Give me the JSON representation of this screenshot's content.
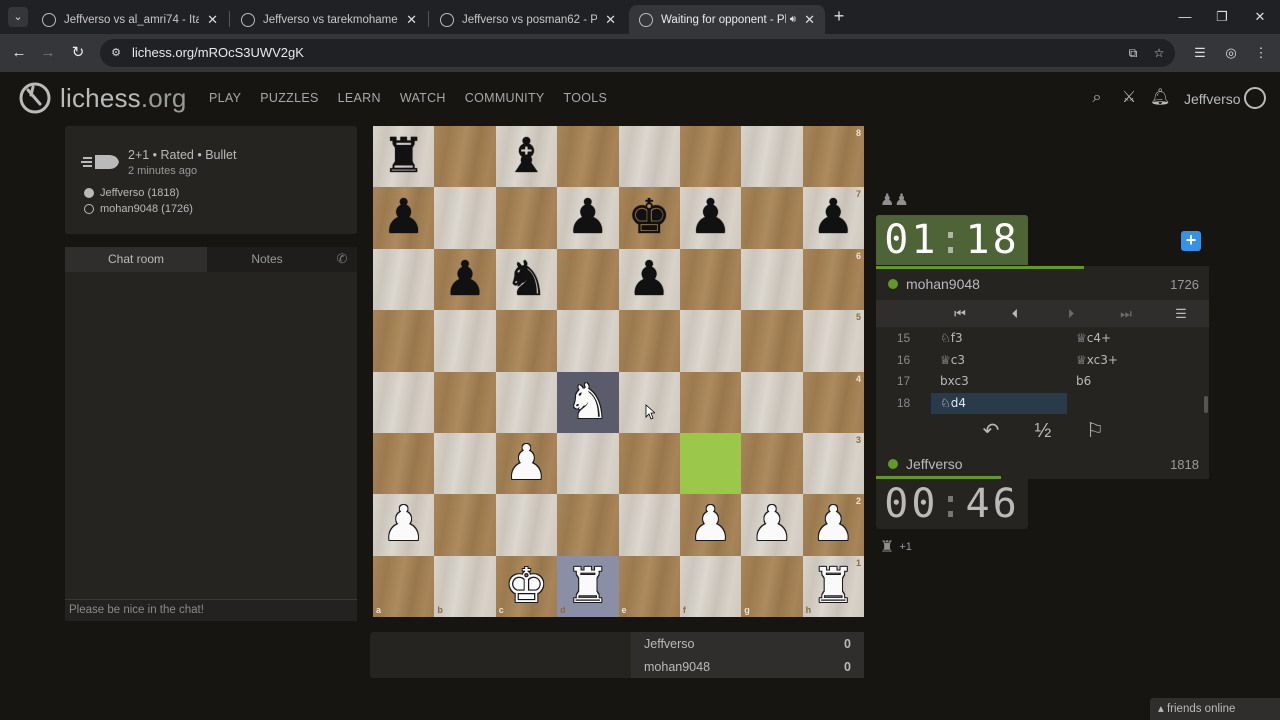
{
  "browser": {
    "tabs": [
      {
        "title": "Jeffverso vs al_amri74 - Italian G"
      },
      {
        "title": "Jeffverso vs tarekmohamedm -"
      },
      {
        "title": "Jeffverso vs posman62 - Philidc"
      },
      {
        "title": "Waiting for opponent - Play"
      }
    ],
    "url": "lichess.org/mROcS3UWV2gK"
  },
  "site": {
    "logo_main": "lichess",
    "logo_tld": ".org",
    "nav": [
      "PLAY",
      "PUZZLES",
      "LEARN",
      "WATCH",
      "COMMUNITY",
      "TOOLS"
    ],
    "username": "Jeffverso"
  },
  "game": {
    "type": "2+1 • Rated • Bullet",
    "time_ago": "2 minutes ago",
    "white_player": "Jeffverso (1818)",
    "black_player": "mohan9048 (1726)"
  },
  "chat": {
    "tab_chat": "Chat room",
    "tab_notes": "Notes",
    "placeholder": "Please be nice in the chat!"
  },
  "board": {
    "orientation": "white",
    "pieces": [
      {
        "sq": "a8",
        "color": "b",
        "type": "rook"
      },
      {
        "sq": "c8",
        "color": "b",
        "type": "bishop"
      },
      {
        "sq": "a7",
        "color": "b",
        "type": "pawn"
      },
      {
        "sq": "d7",
        "color": "b",
        "type": "pawn"
      },
      {
        "sq": "e7",
        "color": "b",
        "type": "king"
      },
      {
        "sq": "f7",
        "color": "b",
        "type": "pawn"
      },
      {
        "sq": "h7",
        "color": "b",
        "type": "pawn"
      },
      {
        "sq": "b6",
        "color": "b",
        "type": "pawn"
      },
      {
        "sq": "c6",
        "color": "b",
        "type": "knight"
      },
      {
        "sq": "e6",
        "color": "b",
        "type": "pawn"
      },
      {
        "sq": "d4",
        "color": "w",
        "type": "knight"
      },
      {
        "sq": "c3",
        "color": "w",
        "type": "pawn"
      },
      {
        "sq": "a2",
        "color": "w",
        "type": "pawn"
      },
      {
        "sq": "f2",
        "color": "w",
        "type": "pawn"
      },
      {
        "sq": "g2",
        "color": "w",
        "type": "pawn"
      },
      {
        "sq": "h2",
        "color": "w",
        "type": "pawn"
      },
      {
        "sq": "c1",
        "color": "w",
        "type": "king"
      },
      {
        "sq": "d1",
        "color": "w",
        "type": "rook"
      },
      {
        "sq": "h1",
        "color": "w",
        "type": "rook"
      }
    ],
    "highlight_last": "f3",
    "highlight_move": "d4",
    "highlight_selected": "d1",
    "files": [
      "a",
      "b",
      "c",
      "d",
      "e",
      "f",
      "g",
      "h"
    ],
    "ranks": [
      "8",
      "7",
      "6",
      "5",
      "4",
      "3",
      "2",
      "1"
    ]
  },
  "clocks": {
    "top": {
      "min": "01",
      "sec": "18"
    },
    "bottom": {
      "min": "00",
      "sec": "46"
    }
  },
  "players": {
    "top": {
      "name": "mohan9048",
      "rating": "1726"
    },
    "bottom": {
      "name": "Jeffverso",
      "rating": "1818"
    }
  },
  "material": {
    "bottom_plus": "+1"
  },
  "moves": [
    {
      "n": "15",
      "white": "♘f3",
      "black": "♕c4+"
    },
    {
      "n": "16",
      "white": "♕c3",
      "black": "♕xc3+"
    },
    {
      "n": "17",
      "white": "bxc3",
      "black": "b6"
    },
    {
      "n": "18",
      "white": "♘d4",
      "black": ""
    }
  ],
  "actions": {
    "draw": "½"
  },
  "score": [
    {
      "name": "Jeffverso",
      "value": "0"
    },
    {
      "name": "mohan9048",
      "value": "0"
    }
  ],
  "footer": {
    "friends": "friends online"
  },
  "colors": {
    "accent_green": "#629924",
    "clock_active": "#4e6336",
    "last_move": "#9bc84b",
    "plus_button": "#3692e7"
  }
}
